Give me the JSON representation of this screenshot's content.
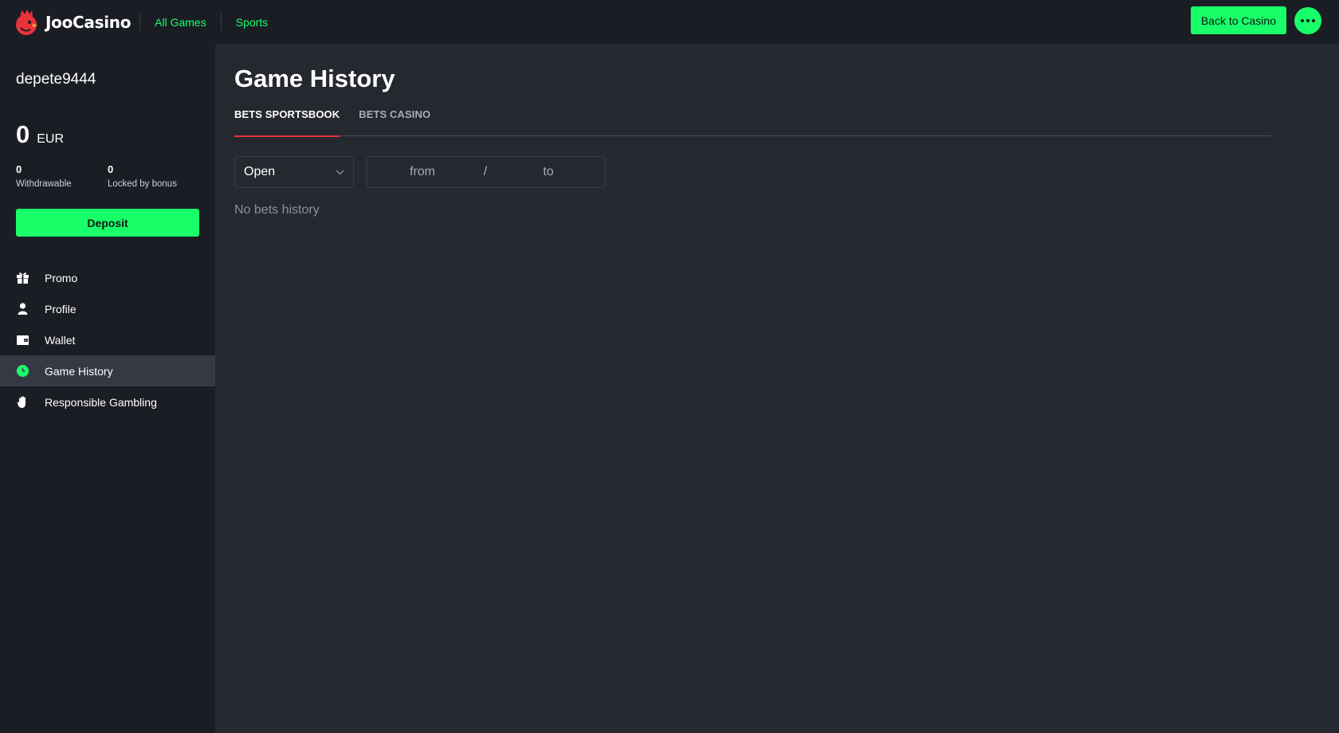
{
  "header": {
    "brand": "JooCasino",
    "nav": [
      {
        "label": "All Games"
      },
      {
        "label": "Sports"
      }
    ],
    "back_label": "Back to Casino"
  },
  "sidebar": {
    "username": "depete9444",
    "balance": {
      "amount": "0",
      "currency": "EUR"
    },
    "withdrawable": {
      "value": "0",
      "label": "Withdrawable"
    },
    "locked": {
      "value": "0",
      "label": "Locked by bonus"
    },
    "deposit_label": "Deposit",
    "items": [
      {
        "label": "Promo",
        "icon": "gift-icon"
      },
      {
        "label": "Profile",
        "icon": "user-icon"
      },
      {
        "label": "Wallet",
        "icon": "wallet-icon"
      },
      {
        "label": "Game History",
        "icon": "clock-icon",
        "active": true
      },
      {
        "label": "Responsible Gambling",
        "icon": "hand-icon"
      }
    ]
  },
  "main": {
    "title": "Game History",
    "tabs": [
      {
        "label": "BETS SPORTSBOOK",
        "active": true
      },
      {
        "label": "BETS CASINO"
      }
    ],
    "filter": {
      "status": "Open",
      "from_placeholder": "from",
      "separator": "/",
      "to_placeholder": "to"
    },
    "empty_message": "No bets history"
  },
  "colors": {
    "accent": "#19ff6a",
    "tab_underline": "#e8333b",
    "header_bg": "#1b1d24",
    "main_bg": "#262830"
  }
}
